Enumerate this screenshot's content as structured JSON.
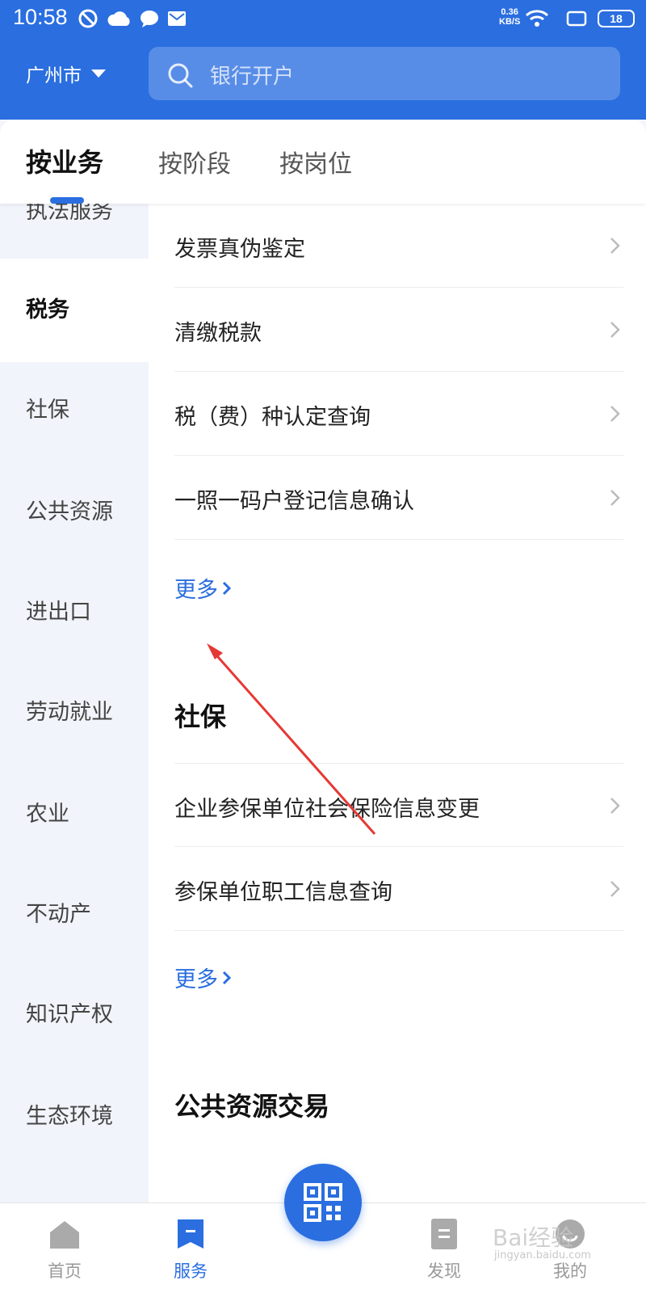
{
  "status_bar": {
    "time": "10:58",
    "speed_value": "0.36",
    "speed_unit": "KB/S",
    "battery": "18"
  },
  "header": {
    "city": "广州市",
    "search_placeholder": "银行开户"
  },
  "tabs": [
    "按业务",
    "按阶段",
    "按岗位"
  ],
  "sidebar": {
    "items": [
      {
        "label": "执法服务",
        "active": false
      },
      {
        "label": "税务",
        "active": true
      },
      {
        "label": "社保",
        "active": false
      },
      {
        "label": "公共资源",
        "active": false
      },
      {
        "label": "进出口",
        "active": false
      },
      {
        "label": "劳动就业",
        "active": false
      },
      {
        "label": "农业",
        "active": false
      },
      {
        "label": "不动产",
        "active": false
      },
      {
        "label": "知识产权",
        "active": false
      },
      {
        "label": "生态环境",
        "active": false
      }
    ]
  },
  "content": {
    "tax_items": [
      "发票真伪鉴定",
      "清缴税款",
      "税（费）种认定查询",
      "一照一码户登记信息确认"
    ],
    "more_label": "更多",
    "social_title": "社保",
    "social_items": [
      "企业参保单位社会保险信息变更",
      "参保单位职工信息查询"
    ],
    "public_title": "公共资源交易"
  },
  "bottom_nav": {
    "items": [
      "首页",
      "服务",
      "发现",
      "我的"
    ],
    "active": "服务"
  },
  "colors": {
    "primary": "#2a6ee0",
    "annotation_arrow": "#e53935"
  },
  "watermark": {
    "text": "Bai经验",
    "sub": "jingyan.baidu.com"
  }
}
